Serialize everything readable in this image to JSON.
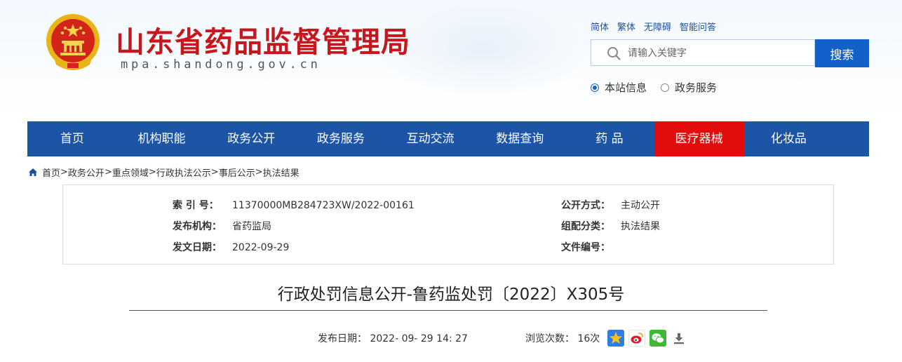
{
  "header": {
    "site_title": "山东省药品监督管理局",
    "site_domain": "mpa.shandong.gov.cn",
    "lang_links": [
      "简体",
      "繁体",
      "无障碍",
      "智能问答"
    ],
    "search": {
      "placeholder": "请输入关键字",
      "button_label": "搜索"
    },
    "scope_options": [
      {
        "label": "本站信息",
        "checked": true
      },
      {
        "label": "政务服务",
        "checked": false
      }
    ]
  },
  "nav": {
    "items": [
      {
        "label": "首页"
      },
      {
        "label": "机构职能"
      },
      {
        "label": "政务公开"
      },
      {
        "label": "政务服务"
      },
      {
        "label": "互动交流"
      },
      {
        "label": "数据查询"
      },
      {
        "label": "药 品"
      },
      {
        "label": "医疗器械",
        "active": true
      },
      {
        "label": "化妆品"
      }
    ],
    "colors": {
      "bar": "#1c54a6",
      "active": "#e30c0c"
    }
  },
  "breadcrumb": {
    "items": [
      "首页",
      "政务公开",
      "重点领域",
      "行政执法公示",
      "事后公示",
      "执法结果"
    ],
    "separator": ">"
  },
  "meta": {
    "index_label": "索 引 号：",
    "index_value": "11370000MB284723XW/2022-00161",
    "publisher_label": "发布机构：",
    "publisher_value": "省药监局",
    "date_label": "发文日期：",
    "date_value": "2022-09-29",
    "open_mode_label": "公开方式：",
    "open_mode_value": "主动公开",
    "category_label": "组配分类：",
    "category_value": "执法结果",
    "doc_number_label": "文件编号：",
    "doc_number_value": ""
  },
  "article": {
    "title": "行政处罚信息公开-鲁药监处罚〔2022〕X305号",
    "publish_label": "发布日期：",
    "publish_value": "2022- 09- 29 14: 27",
    "views_label": "浏览次数：",
    "views_value": "16次"
  },
  "share_icons": [
    "qzone-icon",
    "weibo-icon",
    "wechat-icon",
    "download-icon"
  ],
  "colors": {
    "brand_red": "#c8161d",
    "link_blue": "#1e4f9f",
    "search_blue": "#1360c8"
  }
}
